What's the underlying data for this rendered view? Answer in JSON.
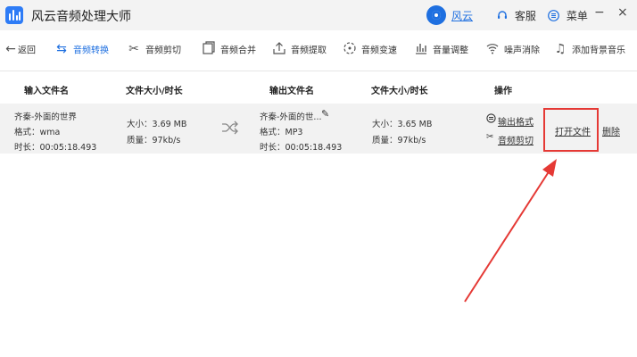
{
  "titlebar": {
    "app_title": "风云音频处理大师",
    "user_name": "风云",
    "service_label": "客服",
    "menu_label": "菜单",
    "minimize": "−",
    "close": "×"
  },
  "toolbar": {
    "back": "返回",
    "items": [
      "音频转换",
      "音频剪切",
      "音频合并",
      "音频提取",
      "音频变速",
      "音量调整",
      "噪声消除",
      "添加背景音乐"
    ]
  },
  "table": {
    "headers": [
      "输入文件名",
      "文件大小/时长",
      "输出文件名",
      "文件大小/时长",
      "操作"
    ],
    "row": {
      "input_name": "齐秦-外面的世界",
      "input_format": "格式：wma",
      "input_duration": "时长：00:05:18.493",
      "input_size": "大小：3.69 MB",
      "input_quality": "质量：97kb/s",
      "output_name": "齐秦-外面的世...",
      "output_format": "格式：MP3",
      "output_duration": "时长：00:05:18.493",
      "output_size": "大小：3.65 MB",
      "output_quality": "质量：97kb/s",
      "op_output_format": "输出格式",
      "op_cut": "音频剪切",
      "op_open_file": "打开文件",
      "op_delete": "删除"
    }
  },
  "colors": {
    "accent": "#1e6fe0",
    "highlight": "#e53935",
    "row_bg": "#f2f2f2"
  }
}
